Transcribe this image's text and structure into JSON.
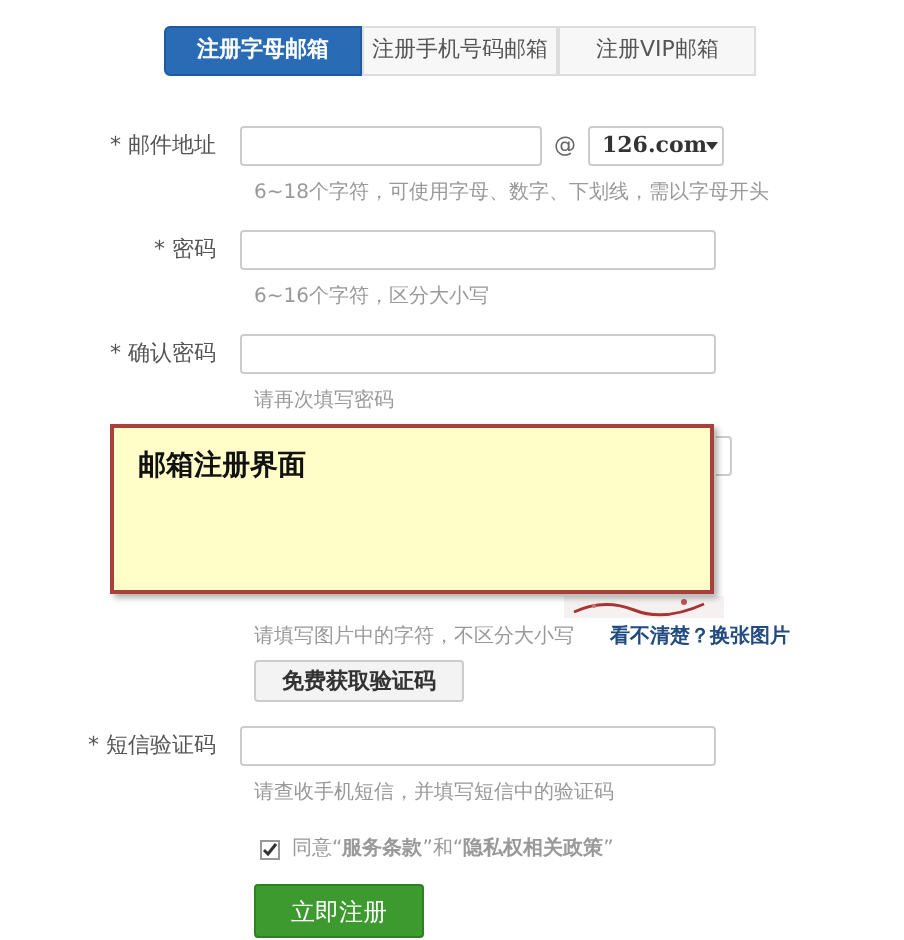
{
  "tabs": [
    {
      "label": "注册字母邮箱",
      "selected": true
    },
    {
      "label": "注册手机号码邮箱",
      "selected": false
    },
    {
      "label": "注册VIP邮箱",
      "selected": false
    }
  ],
  "email": {
    "label": "* 邮件地址",
    "at": "@",
    "domain": "126.com",
    "hint": "6~18个字符，可使用字母、数字、下划线，需以字母开头"
  },
  "password": {
    "label": "* 密码",
    "hint": "6~16个字符，区分大小写"
  },
  "confirm_password": {
    "label": "* 确认密码",
    "hint": "请再次填写密码"
  },
  "captcha": {
    "hint": "请填写图片中的字符，不区分大小写",
    "refresh_link": "看不清楚？换张图片"
  },
  "get_code_button": "免费获取验证码",
  "sms_code": {
    "label": "* 短信验证码",
    "hint": "请查收手机短信，并填写短信中的验证码"
  },
  "agreement": {
    "text": "同意“**服务条款**”和“**隐私权相关政策**”",
    "checked": true
  },
  "register_button": "立即注册",
  "note": {
    "title": "邮箱注册界面"
  }
}
